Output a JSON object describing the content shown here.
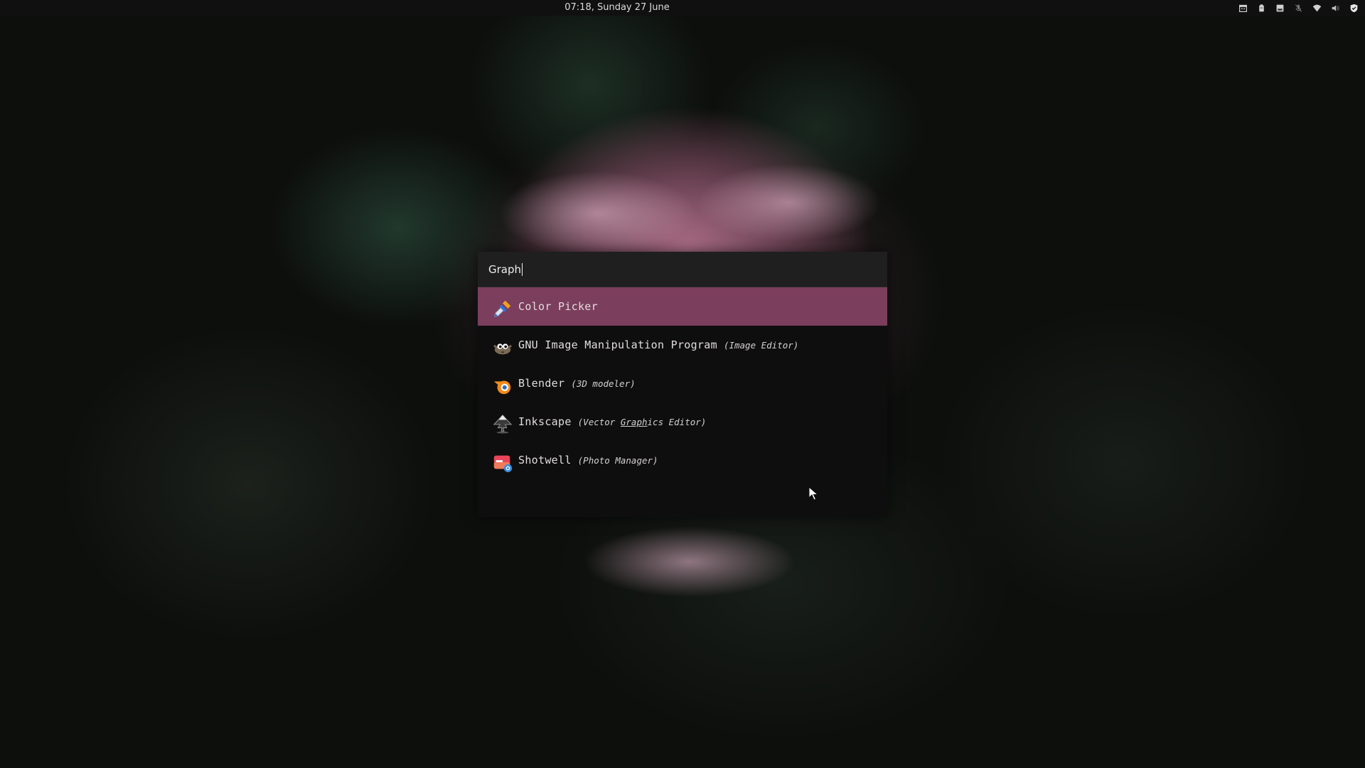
{
  "topbar": {
    "clock": "07:18, Sunday 27 June",
    "tray_icons": [
      "calendar-icon",
      "clipboard-icon",
      "screen-icon",
      "mic-muted-icon",
      "wifi-icon",
      "volume-icon",
      "shield-icon"
    ]
  },
  "launcher": {
    "query": "Graph",
    "results": [
      {
        "name": "Color Picker",
        "description": "",
        "icon": "color-picker-icon",
        "selected": true
      },
      {
        "name": "GNU Image Manipulation Program",
        "description": "(Image Editor)",
        "icon": "gimp-icon",
        "selected": false
      },
      {
        "name": "Blender",
        "description": "(3D modeler)",
        "icon": "blender-icon",
        "selected": false
      },
      {
        "name": "Inkscape",
        "description_pre": "(Vector ",
        "description_match": "Graph",
        "description_post": "ics Editor)",
        "icon": "inkscape-icon",
        "selected": false
      },
      {
        "name": "Shotwell",
        "description": "(Photo Manager)",
        "icon": "shotwell-icon",
        "selected": false
      }
    ]
  },
  "colors": {
    "selection": "#7b3e5c",
    "panel": "#0e0e0e",
    "search_bg": "#1f1f1f"
  }
}
